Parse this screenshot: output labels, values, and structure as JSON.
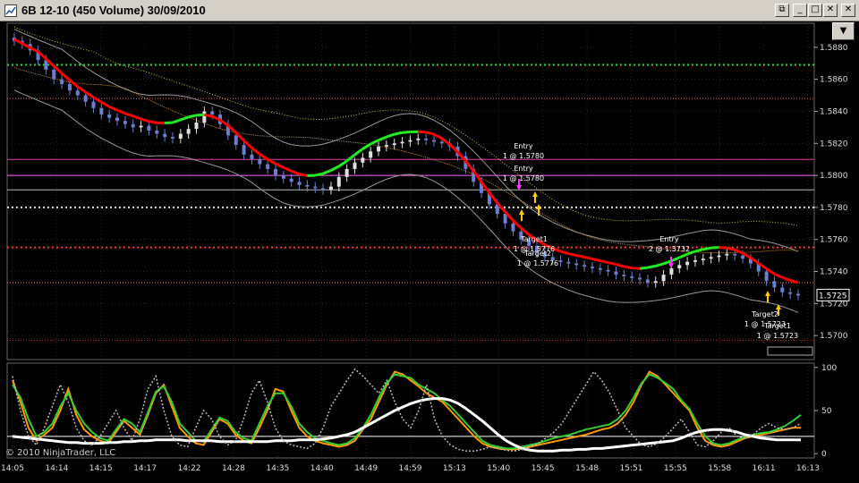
{
  "window": {
    "title": "6B 12-10 (450 Volume)  30/09/2010",
    "minimize_glyph": "_",
    "maximize_glyph": "□",
    "close_glyph": "✕",
    "restore_glyph": "⧉",
    "dropdown_glyph": "▼",
    "icon": "chart-icon"
  },
  "copyright": "© 2010 NinjaTrader, LLC",
  "colors": {
    "background": "#000000",
    "price_up": "#e0e0e0",
    "price_down": "#6a7fd0",
    "ma_down": "#ff0000",
    "ma_up": "#22ee22",
    "target": "#ffcc00",
    "entry": "#ff33ff"
  },
  "chart_data": [
    {
      "type": "candlestick",
      "title": "",
      "y_ticks": [
        "1.5880",
        "1.5860",
        "1.5840",
        "1.5820",
        "1.5800",
        "1.5780",
        "1.5760",
        "1.5740",
        "1.5720",
        "1.5700"
      ],
      "ylim": [
        1.5685,
        1.5895
      ],
      "current_price": "1.5725",
      "x_ticks": [
        "14:05",
        "14:14",
        "14:15",
        "14:17",
        "14:22",
        "14:28",
        "14:35",
        "14:40",
        "14:49",
        "14:59",
        "15:13",
        "15:40",
        "15:45",
        "15:48",
        "15:51",
        "15:55",
        "15:58",
        "16:11",
        "16:13"
      ],
      "closes": [
        1.5884,
        1.5882,
        1.5878,
        1.5872,
        1.5866,
        1.586,
        1.5857,
        1.5853,
        1.585,
        1.5846,
        1.5842,
        1.5838,
        1.5836,
        1.5834,
        1.5832,
        1.583,
        1.5831,
        1.5828,
        1.5826,
        1.5824,
        1.5823,
        1.5826,
        1.5829,
        1.5833,
        1.584,
        1.5838,
        1.5832,
        1.5825,
        1.5819,
        1.5813,
        1.581,
        1.5807,
        1.5804,
        1.58,
        1.5798,
        1.5796,
        1.5794,
        1.5793,
        1.5792,
        1.5791,
        1.5793,
        1.5799,
        1.5804,
        1.5808,
        1.5811,
        1.5815,
        1.5818,
        1.5819,
        1.582,
        1.5821,
        1.5822,
        1.5823,
        1.5822,
        1.5821,
        1.582,
        1.5818,
        1.5812,
        1.5804,
        1.5796,
        1.5789,
        1.5782,
        1.5776,
        1.577,
        1.5765,
        1.576,
        1.5756,
        1.5752,
        1.5749,
        1.5747,
        1.5746,
        1.5745,
        1.5744,
        1.5743,
        1.5742,
        1.5741,
        1.574,
        1.5738,
        1.5737,
        1.5736,
        1.5735,
        1.5733,
        1.5734,
        1.5738,
        1.5742,
        1.5744,
        1.5746,
        1.5747,
        1.5748,
        1.5749,
        1.575,
        1.5751,
        1.575,
        1.5748,
        1.5745,
        1.574,
        1.5734,
        1.573,
        1.5727,
        1.5726,
        1.5725
      ],
      "horizontal_levels": [
        {
          "value": 1.5869,
          "color": "#33dd33",
          "style": "dotted"
        },
        {
          "value": 1.5848,
          "color": "#ff6666",
          "style": "dotted-thin"
        },
        {
          "value": 1.581,
          "color": "#dd44aa",
          "style": "solid-thin"
        },
        {
          "value": 1.58,
          "color": "#ff66ff",
          "style": "solid"
        },
        {
          "value": 1.5791,
          "color": "#bbbbbb",
          "style": "solid-thin"
        },
        {
          "value": 1.578,
          "color": "#dddddd",
          "style": "dotted"
        },
        {
          "value": 1.5755,
          "color": "#ff3333",
          "style": "dotted"
        },
        {
          "value": 1.5733,
          "color": "#ff8833",
          "style": "dotted-thin"
        },
        {
          "value": 1.5697,
          "color": "#cc2222",
          "style": "dotted-thin"
        }
      ],
      "trade_labels": [
        {
          "text": "Entry",
          "kind": "entry",
          "anchor": "entry-1"
        },
        {
          "text": "1 @ 1.5780",
          "kind": "entry",
          "anchor": "entry-1"
        },
        {
          "text": "Entry",
          "kind": "entry",
          "anchor": "entry-2"
        },
        {
          "text": "1 @ 1.5780",
          "kind": "entry",
          "anchor": "entry-2"
        },
        {
          "text": "Target1",
          "kind": "target",
          "anchor": "target-1a"
        },
        {
          "text": "1 @ 1.5776",
          "kind": "target",
          "anchor": "target-1a"
        },
        {
          "text": "Target2",
          "kind": "target",
          "anchor": "target-2a"
        },
        {
          "text": "1 @ 1.5776",
          "kind": "target",
          "anchor": "target-2a"
        },
        {
          "text": "Entry",
          "kind": "entry",
          "anchor": "entry-3"
        },
        {
          "text": "2 @ 1.5732",
          "kind": "entry",
          "anchor": "entry-3"
        },
        {
          "text": "Target2",
          "kind": "target",
          "anchor": "target-2b"
        },
        {
          "text": "1 @ 1.5723",
          "kind": "target",
          "anchor": "target-2b"
        },
        {
          "text": "Target1",
          "kind": "target",
          "anchor": "target-1b"
        },
        {
          "text": "1 @ 1.5723",
          "kind": "target",
          "anchor": "target-1b"
        }
      ]
    },
    {
      "type": "line",
      "title": "",
      "y_ticks": [
        "100",
        "50",
        "0"
      ],
      "ylim": [
        -5,
        105
      ],
      "series": [
        {
          "color": "#ff9900",
          "values": [
            85,
            60,
            30,
            15,
            22,
            30,
            50,
            75,
            45,
            28,
            20,
            15,
            12,
            25,
            38,
            30,
            22,
            45,
            70,
            80,
            55,
            30,
            20,
            12,
            10,
            25,
            40,
            35,
            22,
            15,
            12,
            30,
            50,
            75,
            72,
            50,
            30,
            20,
            15,
            12,
            10,
            8,
            10,
            15,
            28,
            40,
            60,
            80,
            95,
            92,
            85,
            78,
            70,
            65,
            60,
            50,
            40,
            30,
            20,
            12,
            8,
            6,
            5,
            5,
            6,
            8,
            10,
            12,
            14,
            16,
            18,
            20,
            22,
            25,
            28,
            30,
            35,
            45,
            60,
            80,
            95,
            90,
            80,
            70,
            60,
            50,
            30,
            15,
            10,
            8,
            10,
            14,
            18,
            20,
            22,
            24,
            26,
            28,
            30,
            30
          ]
        },
        {
          "color": "#33cc33",
          "values": [
            80,
            65,
            40,
            20,
            25,
            35,
            55,
            70,
            50,
            35,
            25,
            18,
            15,
            28,
            40,
            35,
            25,
            48,
            72,
            78,
            60,
            35,
            25,
            15,
            14,
            28,
            42,
            38,
            25,
            18,
            15,
            35,
            55,
            70,
            70,
            55,
            35,
            25,
            18,
            15,
            12,
            10,
            12,
            18,
            30,
            45,
            65,
            82,
            92,
            90,
            88,
            80,
            75,
            70,
            62,
            55,
            45,
            35,
            25,
            15,
            10,
            8,
            6,
            6,
            8,
            10,
            12,
            15,
            18,
            20,
            22,
            25,
            28,
            30,
            32,
            34,
            40,
            50,
            65,
            82,
            92,
            88,
            82,
            75,
            62,
            52,
            35,
            20,
            12,
            10,
            12,
            16,
            20,
            22,
            24,
            25,
            28,
            32,
            38,
            45
          ]
        },
        {
          "color": "#ffffff",
          "values": [
            20,
            19,
            18,
            17,
            16,
            15,
            14,
            13,
            13,
            12,
            12,
            12,
            13,
            13,
            14,
            14,
            15,
            15,
            16,
            16,
            16,
            16,
            15,
            15,
            15,
            15,
            14,
            14,
            14,
            14,
            14,
            14,
            14,
            15,
            15,
            15,
            16,
            16,
            16,
            17,
            18,
            20,
            22,
            25,
            30,
            35,
            40,
            45,
            50,
            54,
            58,
            61,
            63,
            64,
            64,
            62,
            58,
            52,
            45,
            38,
            30,
            22,
            15,
            10,
            6,
            4,
            3,
            3,
            3,
            4,
            4,
            5,
            5,
            6,
            6,
            7,
            8,
            9,
            10,
            11,
            12,
            13,
            14,
            15,
            18,
            22,
            25,
            27,
            28,
            28,
            27,
            25,
            22,
            20,
            18,
            17,
            16,
            16,
            16,
            16
          ]
        },
        {
          "color": "#bbbbbb",
          "style": "dotted",
          "values": [
            90,
            50,
            20,
            10,
            30,
            55,
            80,
            60,
            30,
            15,
            10,
            20,
            35,
            50,
            30,
            15,
            40,
            75,
            90,
            50,
            20,
            10,
            8,
            30,
            50,
            40,
            20,
            10,
            15,
            40,
            70,
            85,
            60,
            30,
            15,
            10,
            8,
            6,
            12,
            30,
            55,
            70,
            85,
            98,
            90,
            80,
            70,
            85,
            60,
            40,
            30,
            50,
            80,
            40,
            20,
            10,
            5,
            3,
            3,
            5,
            8,
            6,
            4,
            3,
            5,
            8,
            12,
            18,
            25,
            35,
            50,
            65,
            80,
            95,
            85,
            70,
            50,
            30,
            20,
            10,
            8,
            12,
            20,
            30,
            40,
            25,
            10,
            8,
            15,
            25,
            30,
            20,
            18,
            22,
            30,
            35,
            30,
            28,
            30,
            35
          ]
        }
      ],
      "levels": [
        {
          "value": 20,
          "color": "#ffffff"
        }
      ]
    }
  ]
}
